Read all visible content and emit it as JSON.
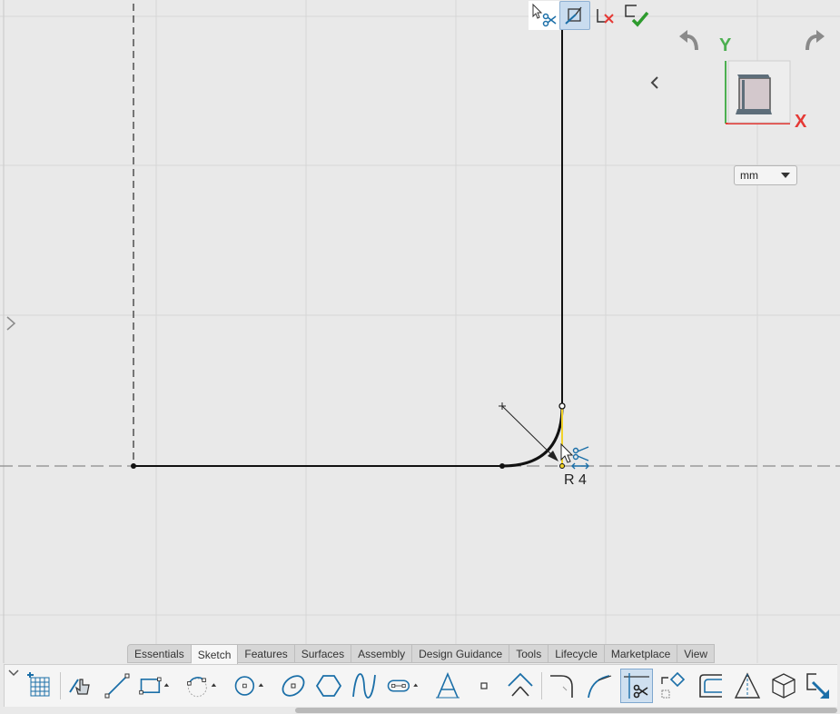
{
  "sketch": {
    "radius_label": "R 4"
  },
  "view_cube": {
    "y_axis_label": "Y",
    "x_axis_label": "X",
    "y_color": "#4caf50",
    "x_color": "#e53935"
  },
  "units": {
    "selected": "mm"
  },
  "top_tools": [
    {
      "icon": "select-trim-icon"
    },
    {
      "icon": "sketch-plane-view-icon"
    },
    {
      "icon": "cancel-sketch-icon"
    },
    {
      "icon": "finish-sketch-icon"
    }
  ],
  "tabs": [
    {
      "label": "Essentials"
    },
    {
      "label": "Sketch",
      "active": true
    },
    {
      "label": "Features"
    },
    {
      "label": "Surfaces"
    },
    {
      "label": "Assembly"
    },
    {
      "label": "Design Guidance"
    },
    {
      "label": "Tools"
    },
    {
      "label": "Lifecycle"
    },
    {
      "label": "Marketplace"
    },
    {
      "label": "View"
    }
  ],
  "toolbar": [
    "sketch-grid-icon",
    "smart-pick-icon",
    "line-icon",
    "rectangle-icon",
    "arc-icon",
    "circle-icon",
    "ellipse-icon",
    "polygon-icon",
    "spline-icon",
    "slot-icon",
    "text-icon",
    "point-icon",
    "mirror-line-icon",
    "fillet-icon",
    "tangent-arc-icon",
    "trim-icon",
    "constraint-icon",
    "offset-icon",
    "dimension-icon",
    "project-icon",
    "exit-icon"
  ],
  "accent": "#1b6fa8"
}
